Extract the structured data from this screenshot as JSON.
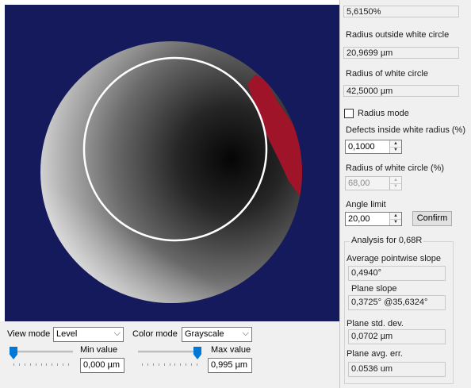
{
  "panel": {
    "value_top": "5,6150%",
    "radius_outside_label": "Radius outside white circle",
    "radius_outside_value": "20,9699 µm",
    "radius_white_label": "Radius of white circle",
    "radius_white_value": "42,5000 µm",
    "radius_mode_label": "Radius mode",
    "radius_mode_checked": false,
    "defects_label": "Defects inside white radius (%)",
    "defects_value": "0,1000",
    "radius_white_pct_label": "Radius of white circle (%)",
    "radius_white_pct_value": "68,00",
    "angle_limit_label": "Angle limit",
    "angle_limit_value": "20,00",
    "confirm_label": "Confirm",
    "analysis": {
      "title": "Analysis for 0,68R",
      "avg_slope_label": "Average pointwise slope",
      "avg_slope_value": "0,4940°",
      "plane_slope_label": "Plane slope",
      "plane_slope_value": "0,3725° @35,6324°",
      "plane_std_label": "Plane std. dev.",
      "plane_std_value": "0,0702 µm",
      "plane_avg_label": "Plane avg. err.",
      "plane_avg_value": "0.0536 um"
    }
  },
  "bottom": {
    "view_mode_label": "View mode",
    "view_mode_value": "Level",
    "color_mode_label": "Color mode",
    "color_mode_value": "Grayscale",
    "min_label": "Min value",
    "min_value": "0,000 µm",
    "max_label": "Max value",
    "max_value": "0,995 µm",
    "min_slider_fraction": 0.0,
    "max_slider_fraction": 1.0
  },
  "colors": {
    "background": "#141a5c",
    "defect": "#a0142a",
    "circle": "#ffffff"
  },
  "icons": {
    "dropdown": "chevron-down-icon",
    "spin_up": "triangle-up-icon",
    "spin_down": "triangle-down-icon"
  }
}
